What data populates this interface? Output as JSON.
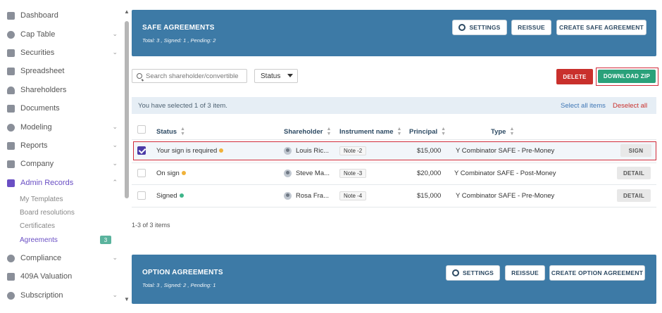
{
  "sidebar": {
    "items": [
      {
        "label": "Dashboard"
      },
      {
        "label": "Cap Table"
      },
      {
        "label": "Securities"
      },
      {
        "label": "Spreadsheet"
      },
      {
        "label": "Shareholders"
      },
      {
        "label": "Documents"
      },
      {
        "label": "Modeling"
      },
      {
        "label": "Reports"
      },
      {
        "label": "Company"
      },
      {
        "label": "Admin Records"
      },
      {
        "label": "Compliance"
      },
      {
        "label": "409A Valuation"
      },
      {
        "label": "Subscription"
      }
    ],
    "sub_items": [
      {
        "label": "My Templates"
      },
      {
        "label": "Board resolutions"
      },
      {
        "label": "Certificates"
      },
      {
        "label": "Agreements",
        "badge": "3"
      }
    ]
  },
  "safe": {
    "title": "SAFE AGREEMENTS",
    "summary": "Total: 3 , Signed: 1 , Pending: 2",
    "settings_label": "SETTINGS",
    "reissue_label": "REISSUE",
    "create_label": "CREATE SAFE AGREEMENT"
  },
  "toolbar": {
    "search_placeholder": "Search shareholder/convertible",
    "status_select": "Status",
    "delete_label": "DELETE",
    "download_label": "DOWNLOAD ZIP"
  },
  "selection": {
    "text": "You have selected 1 of 3 item.",
    "select_all": "Select all items",
    "deselect_all": "Deselect all"
  },
  "table": {
    "headers": {
      "status": "Status",
      "shareholder": "Shareholder",
      "instrument": "Instrument name",
      "principal": "Principal",
      "type": "Type"
    },
    "rows": [
      {
        "status": "Your sign is required",
        "shareholder": "Louis Ric...",
        "instrument": "Note -2",
        "principal": "$15,000",
        "type": "Y Combinator SAFE - Pre-Money",
        "action": "SIGN"
      },
      {
        "status": "On sign",
        "shareholder": "Steve Ma...",
        "instrument": "Note -3",
        "principal": "$20,000",
        "type": "Y Combinator SAFE - Post-Money",
        "action": "DETAIL"
      },
      {
        "status": "Signed",
        "shareholder": "Rosa Fra...",
        "instrument": "Note -4",
        "principal": "$15,000",
        "type": "Y Combinator SAFE - Pre-Money",
        "action": "DETAIL"
      }
    ],
    "count": "1-3 of 3 items"
  },
  "option": {
    "title": "OPTION AGREEMENTS",
    "summary": "Total: 3 , Signed: 2 , Pending: 1",
    "settings_label": "SETTINGS",
    "reissue_label": "REISSUE",
    "create_label": "CREATE OPTION AGREEMENT"
  },
  "colors": {
    "header": "#3d7aa6",
    "accent": "#6a4fc4",
    "delete": "#c9302c",
    "download": "#2aa17a",
    "pending_dot": "#f0b23a",
    "signed_dot": "#3fb58a"
  }
}
